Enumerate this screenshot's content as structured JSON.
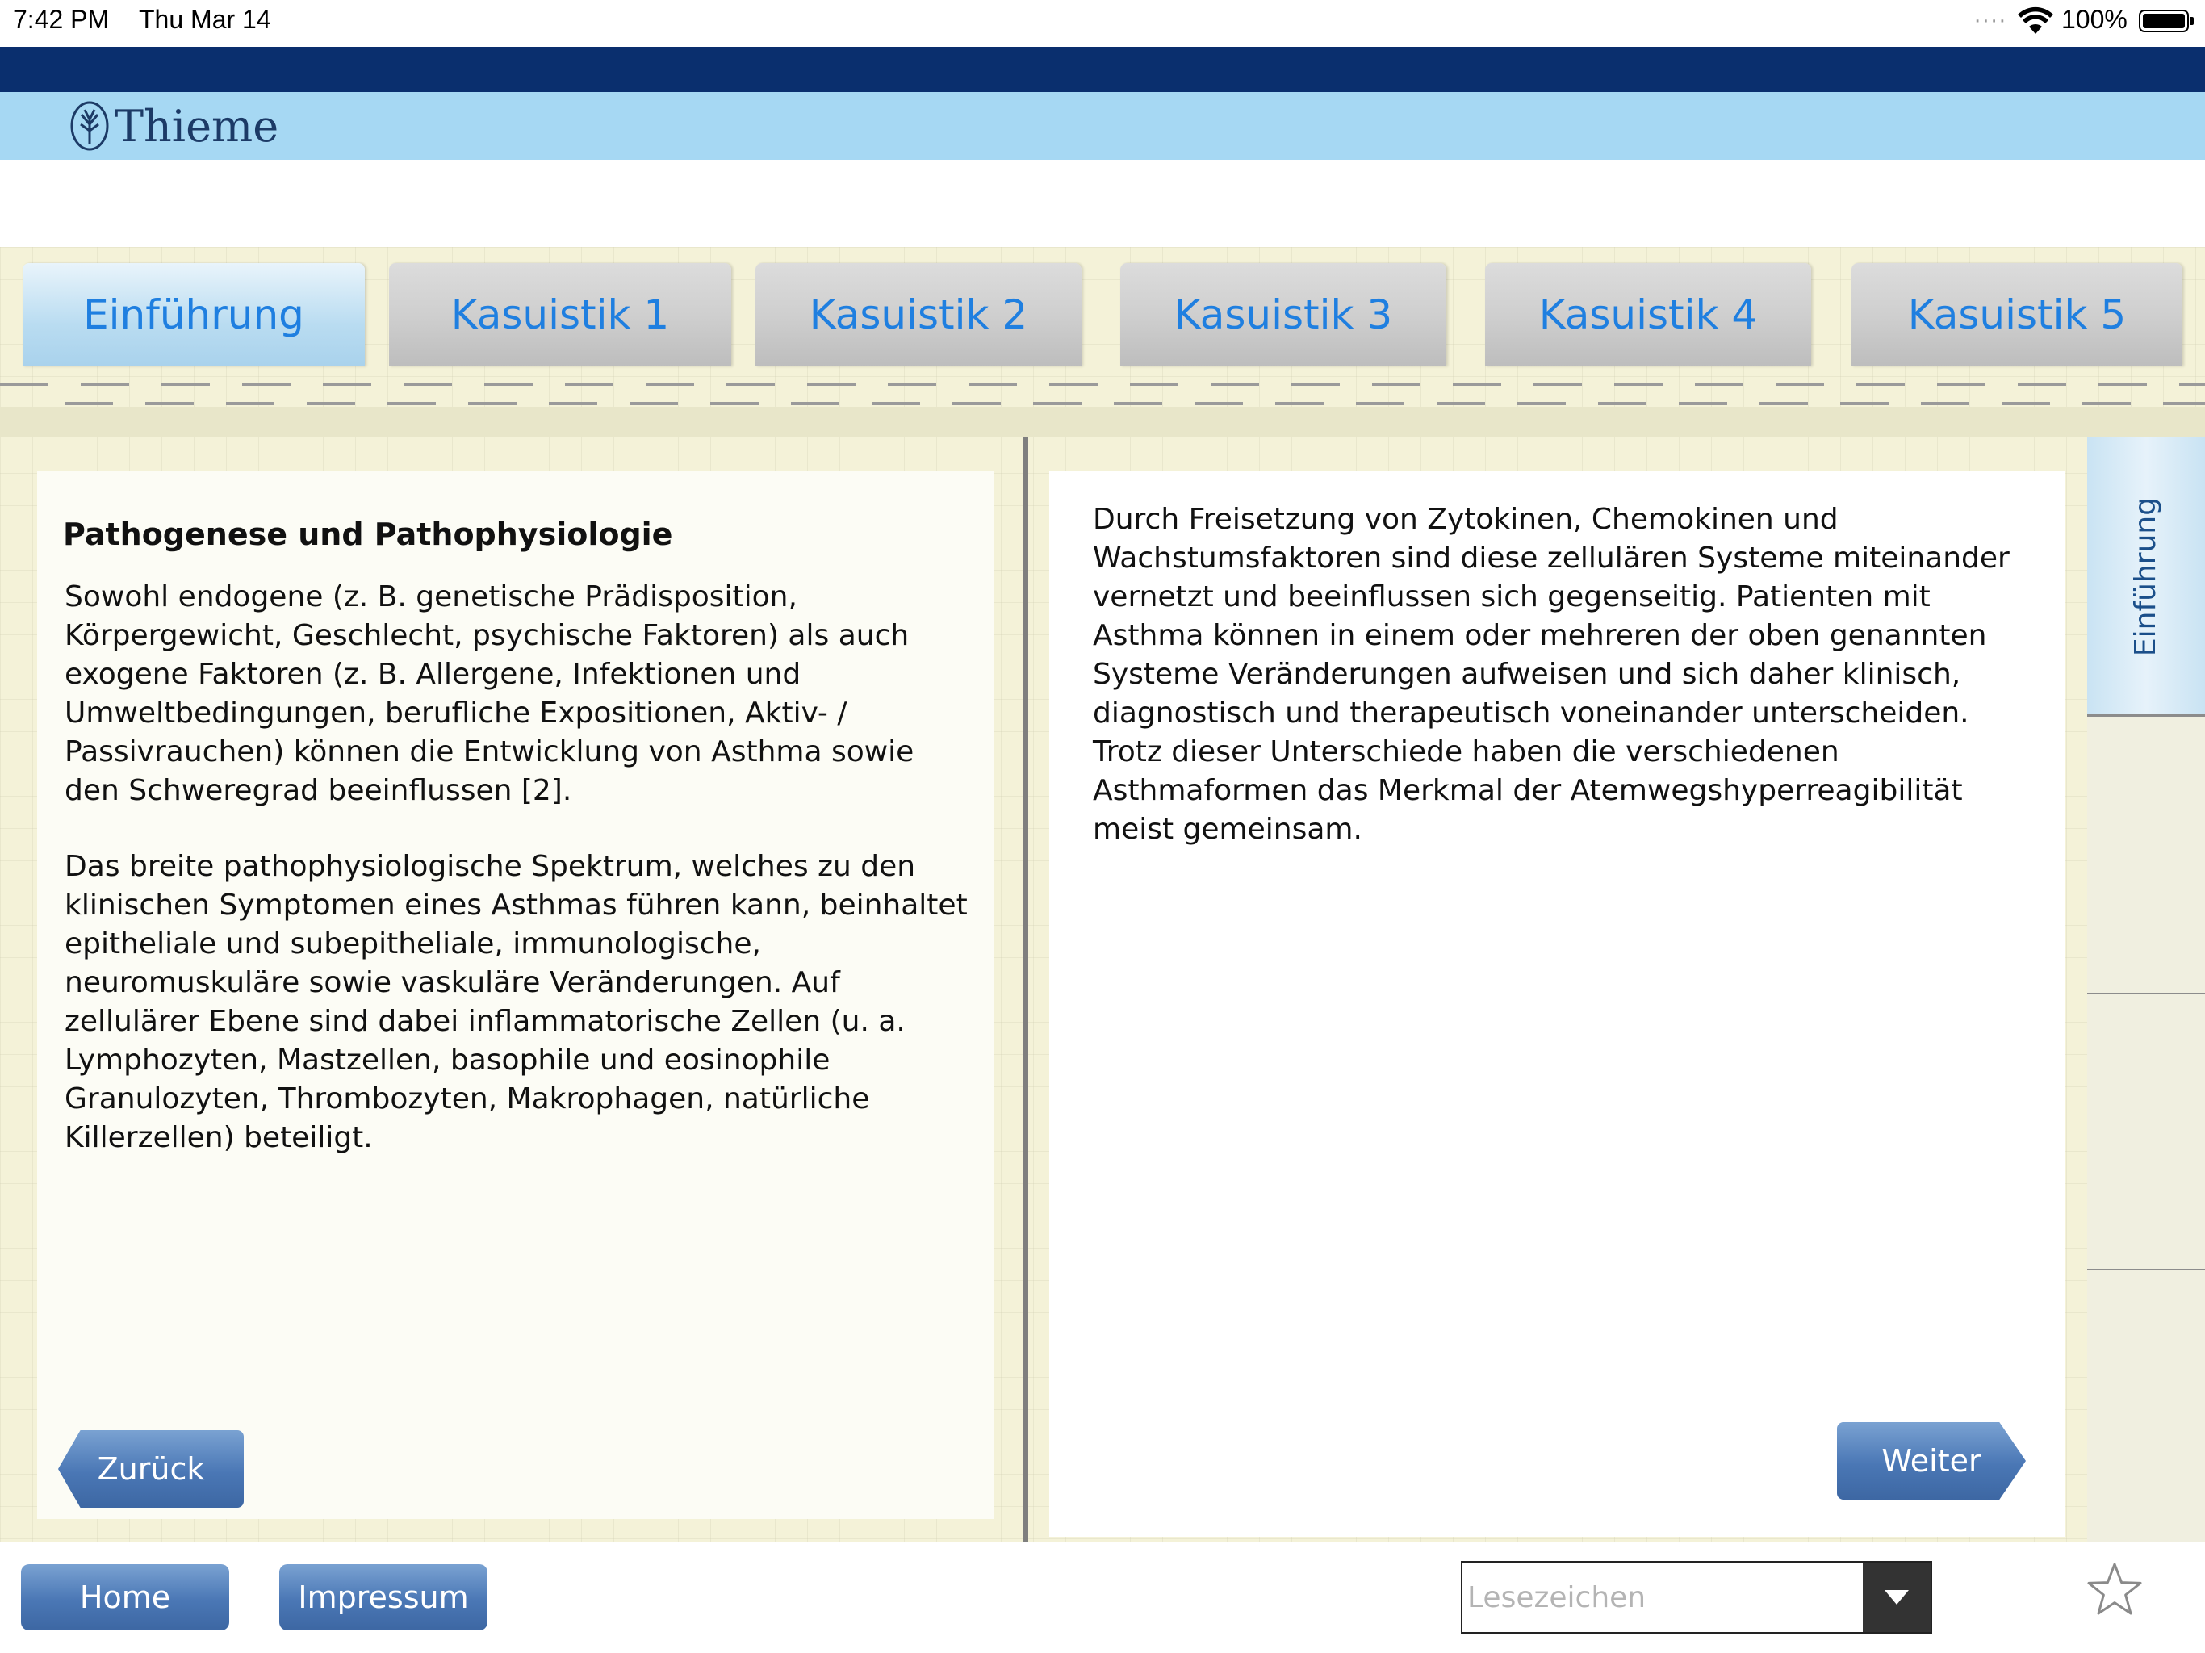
{
  "status_bar": {
    "time": "7:42 PM",
    "date": "Thu Mar 14",
    "battery": "100%",
    "battery_level": 1.0
  },
  "header": {
    "logo_text": "Thieme"
  },
  "tabs": [
    {
      "label": "Einführung",
      "active": true
    },
    {
      "label": "Kasuistik 1",
      "active": false
    },
    {
      "label": "Kasuistik 2",
      "active": false
    },
    {
      "label": "Kasuistik 3",
      "active": false
    },
    {
      "label": "Kasuistik 4",
      "active": false
    },
    {
      "label": "Kasuistik 5",
      "active": false
    }
  ],
  "left_page": {
    "heading": "Pathogenese und Pathophysiologie",
    "paragraphs": [
      "Sowohl endogene (z. B. genetische Prädisposition, Körpergewicht, Geschlecht, psychische Faktoren) als auch exogene Faktoren (z. B. Allergene, Infektionen und Umweltbedingungen, berufliche Expositionen, Aktiv- / Passivrauchen) können die Entwicklung von Asthma sowie den Schweregrad beeinflussen [2].",
      "Das breite pathophysiologische Spektrum, welches zu den klinischen Symptomen eines Asthmas führen kann, beinhaltet epitheliale und subepitheliale, immunologische, neuromuskuläre sowie vaskuläre Veränderungen. Auf zellulärer Ebene sind dabei inflammatorische Zellen (u. a. Lymphozyten, Mastzellen, basophile und eosinophile Granulozyten, Thrombozyten, Makrophagen, natürliche Killerzellen) beteiligt."
    ]
  },
  "right_page": {
    "paragraphs": [
      "Durch Freisetzung von Zytokinen, Chemokinen und Wachstumsfaktoren sind diese zellulären Systeme miteinander vernetzt und beeinflussen sich gegenseitig. Patienten mit Asthma können in einem oder mehreren der oben genannten Systeme Veränderungen aufweisen und sich daher klinisch, diagnostisch und therapeutisch voneinander unterscheiden. Trotz dieser Unterschiede haben die verschiedenen Asthmaformen das Merkmal der Atemwegshyperreagibilität meist gemeinsam."
    ]
  },
  "side_tab": {
    "label": "Einführung"
  },
  "navigation": {
    "back_label": "Zurück",
    "next_label": "Weiter"
  },
  "bottom_bar": {
    "home_label": "Home",
    "impressum_label": "Impressum",
    "bookmark_placeholder": "Lesezeichen"
  },
  "colors": {
    "navy": "#0a2f6e",
    "light_blue": "#a6d8f3",
    "tab_text": "#1f7fe0",
    "button_blue": "#4a77b5",
    "paper": "#f4f2d8"
  },
  "icons": [
    "thieme-logo-icon",
    "wifi-icon",
    "battery-icon",
    "chevron-down-icon",
    "star-icon"
  ]
}
